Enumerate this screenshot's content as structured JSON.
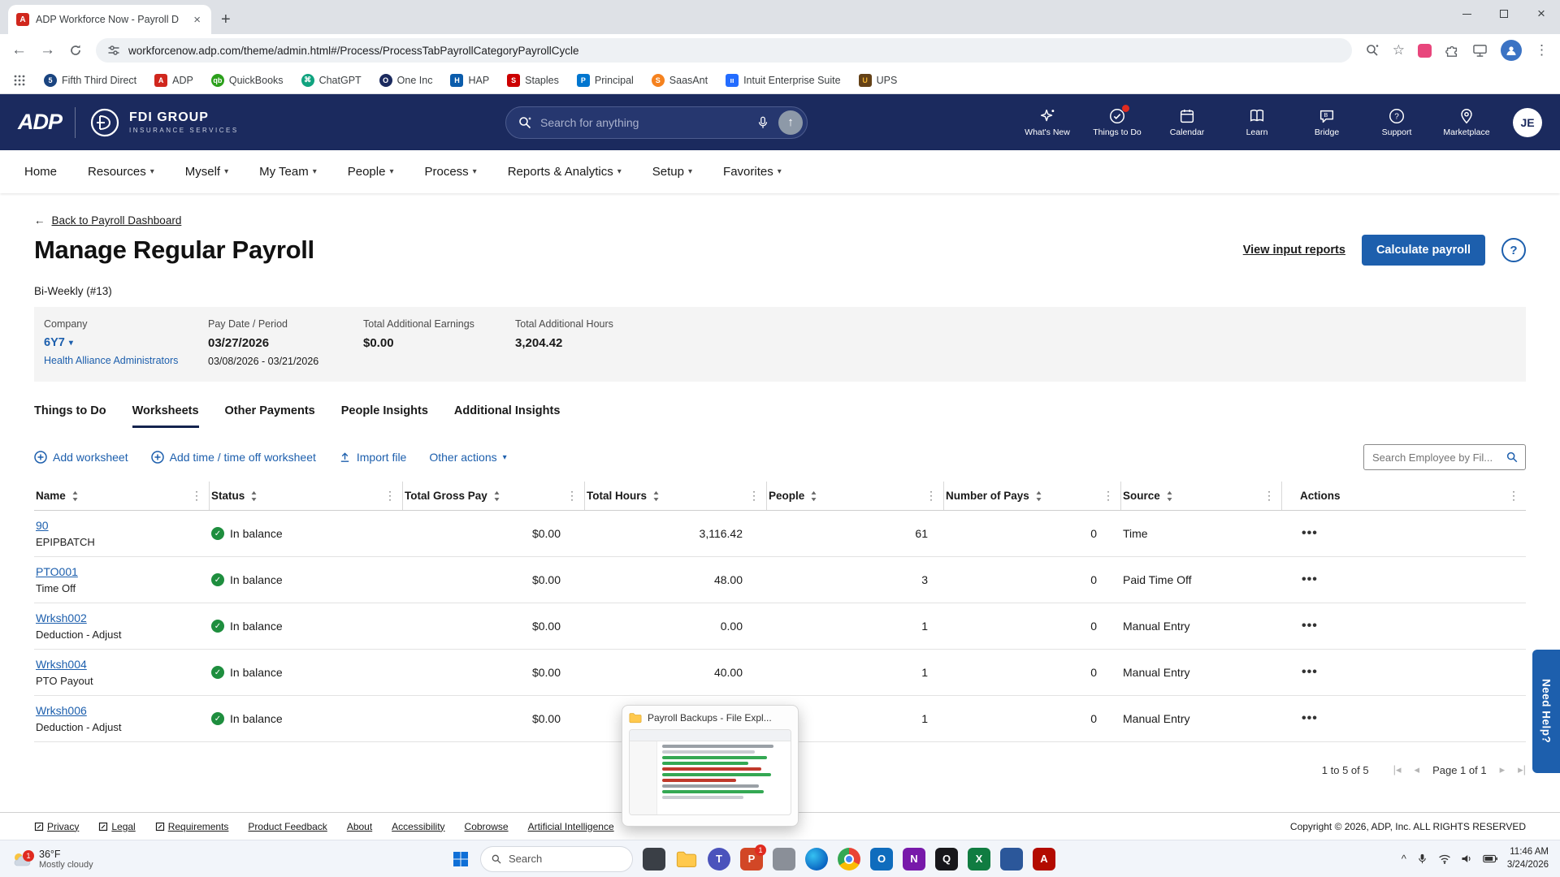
{
  "browser": {
    "tab_title": "ADP Workforce Now - Payroll D",
    "url": "workforcenow.adp.com/theme/admin.html#/Process/ProcessTabPayrollCategoryPayrollCycle",
    "bookmarks": [
      "Fifth Third Direct",
      "ADP",
      "QuickBooks",
      "ChatGPT",
      "One Inc",
      "HAP",
      "Staples",
      "Principal",
      "SaasAnt",
      "Intuit Enterprise Suite",
      "UPS"
    ]
  },
  "app_header": {
    "logo_text": "ADP",
    "company_name": "FDI GROUP",
    "company_tagline": "INSURANCE SERVICES",
    "search_placeholder": "Search for anything",
    "icons": [
      {
        "label": "What's New"
      },
      {
        "label": "Things to Do"
      },
      {
        "label": "Calendar"
      },
      {
        "label": "Learn"
      },
      {
        "label": "Bridge"
      },
      {
        "label": "Support"
      },
      {
        "label": "Marketplace"
      }
    ],
    "avatar_initials": "JE"
  },
  "main_nav": {
    "items": [
      "Home",
      "Resources",
      "Myself",
      "My Team",
      "People",
      "Process",
      "Reports & Analytics",
      "Setup",
      "Favorites"
    ]
  },
  "page": {
    "back_link": "Back to Payroll Dashboard",
    "title": "Manage Regular Payroll",
    "view_reports_link": "View input reports",
    "calculate_button": "Calculate payroll",
    "cycle": "Bi-Weekly (#13)",
    "summary": {
      "company_label": "Company",
      "company_value": "6Y7",
      "company_sub": "Health Alliance Administrators",
      "paydate_label": "Pay Date / Period",
      "paydate_value": "03/27/2026",
      "pay_period": "03/08/2026 - 03/21/2026",
      "earnings_label": "Total Additional Earnings",
      "earnings_value": "$0.00",
      "hours_label": "Total Additional Hours",
      "hours_value": "3,204.42"
    },
    "tabs": [
      "Things to Do",
      "Worksheets",
      "Other Payments",
      "People Insights",
      "Additional Insights"
    ],
    "actions": {
      "add_worksheet": "Add worksheet",
      "add_time": "Add time / time off worksheet",
      "import_file": "Import file",
      "other_actions": "Other actions"
    },
    "search_placeholder": "Search Employee by Fil..."
  },
  "table": {
    "columns": [
      "Name",
      "Status",
      "Total Gross Pay",
      "Total Hours",
      "People",
      "Number of Pays",
      "Source",
      "Actions"
    ],
    "rows": [
      {
        "name": "90",
        "sub": "EPIPBATCH",
        "status": "In balance",
        "gross": "$0.00",
        "hours": "3,116.42",
        "people": "61",
        "pays": "0",
        "source": "Time"
      },
      {
        "name": "PTO001",
        "sub": "Time Off",
        "status": "In balance",
        "gross": "$0.00",
        "hours": "48.00",
        "people": "3",
        "pays": "0",
        "source": "Paid Time Off"
      },
      {
        "name": "Wrksh002",
        "sub": "Deduction - Adjust",
        "status": "In balance",
        "gross": "$0.00",
        "hours": "0.00",
        "people": "1",
        "pays": "0",
        "source": "Manual Entry"
      },
      {
        "name": "Wrksh004",
        "sub": "PTO Payout",
        "status": "In balance",
        "gross": "$0.00",
        "hours": "40.00",
        "people": "1",
        "pays": "0",
        "source": "Manual Entry"
      },
      {
        "name": "Wrksh006",
        "sub": "Deduction - Adjust",
        "status": "In balance",
        "gross": "$0.00",
        "hours": "",
        "people": "1",
        "pays": "0",
        "source": "Manual Entry"
      }
    ]
  },
  "pagination": {
    "range": "1 to 5 of 5",
    "page": "Page 1 of 1"
  },
  "footer": {
    "links": [
      "Privacy",
      "Legal",
      "Requirements",
      "Product Feedback",
      "About",
      "Accessibility",
      "Cobrowse",
      "Artificial Intelligence"
    ],
    "copyright": "Copyright © 2026, ADP, Inc. ALL RIGHTS RESERVED"
  },
  "need_help": "Need Help?",
  "popup": {
    "title": "Payroll Backups - File Expl..."
  },
  "taskbar": {
    "weather_temp": "36°F",
    "weather_condition": "Mostly cloudy",
    "weather_badge": "1",
    "search_placeholder": "Search",
    "ppt_badge": "1",
    "time": "11:46 AM",
    "date": "3/24/2026"
  }
}
